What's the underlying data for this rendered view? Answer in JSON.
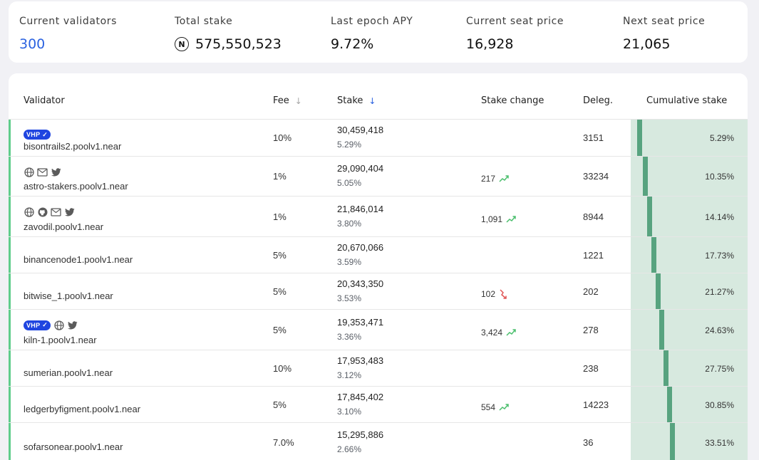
{
  "stats": {
    "current_validators_label": "Current validators",
    "current_validators_value": "300",
    "total_stake_label": "Total stake",
    "total_stake_icon": "near-token-icon",
    "total_stake_value": "575,550,523",
    "last_epoch_apy_label": "Last epoch APY",
    "last_epoch_apy_value": "9.72%",
    "current_seat_price_label": "Current seat price",
    "current_seat_price_value": "16,928",
    "next_seat_price_label": "Next seat price",
    "next_seat_price_value": "21,065"
  },
  "table": {
    "headers": {
      "validator": "Validator",
      "fee": "Fee",
      "stake": "Stake",
      "stake_change": "Stake change",
      "deleg": "Deleg.",
      "cumulative": "Cumulative stake"
    },
    "colors": {
      "accent": "#2b62e0",
      "row_marker": "#5fcd8b",
      "cumulative_bar": "#57a37f",
      "cumulative_bg": "#d7e9df",
      "trend_up": "#4cbf6e",
      "trend_down": "#e05555"
    },
    "rows": [
      {
        "name": "bisontrails2.poolv1.near",
        "badge": "VHP",
        "icons": [
          "verified-badge"
        ],
        "fee": "10%",
        "stake": "30,459,418",
        "stake_pct": "5.29%",
        "change": "",
        "trend": "",
        "deleg": "3151",
        "cum": "5.29%",
        "cum_frac": 0.0529
      },
      {
        "name": "astro-stakers.poolv1.near",
        "badge": "",
        "icons": [
          "globe-icon",
          "mail-icon",
          "twitter-icon"
        ],
        "fee": "1%",
        "stake": "29,090,404",
        "stake_pct": "5.05%",
        "change": "217",
        "trend": "up",
        "deleg": "33234",
        "cum": "10.35%",
        "cum_frac": 0.1035
      },
      {
        "name": "zavodil.poolv1.near",
        "badge": "",
        "icons": [
          "globe-icon",
          "github-icon",
          "mail-icon",
          "twitter-icon"
        ],
        "fee": "1%",
        "stake": "21,846,014",
        "stake_pct": "3.80%",
        "change": "1,091",
        "trend": "up",
        "deleg": "8944",
        "cum": "14.14%",
        "cum_frac": 0.1414
      },
      {
        "name": "binancenode1.poolv1.near",
        "badge": "",
        "icons": [],
        "fee": "5%",
        "stake": "20,670,066",
        "stake_pct": "3.59%",
        "change": "",
        "trend": "",
        "deleg": "1221",
        "cum": "17.73%",
        "cum_frac": 0.1773
      },
      {
        "name": "bitwise_1.poolv1.near",
        "badge": "",
        "icons": [],
        "fee": "5%",
        "stake": "20,343,350",
        "stake_pct": "3.53%",
        "change": "102",
        "trend": "down",
        "deleg": "202",
        "cum": "21.27%",
        "cum_frac": 0.2127
      },
      {
        "name": "kiln-1.poolv1.near",
        "badge": "VHP",
        "icons": [
          "globe-icon",
          "twitter-icon"
        ],
        "fee": "5%",
        "stake": "19,353,471",
        "stake_pct": "3.36%",
        "change": "3,424",
        "trend": "up",
        "deleg": "278",
        "cum": "24.63%",
        "cum_frac": 0.2463
      },
      {
        "name": "sumerian.poolv1.near",
        "badge": "",
        "icons": [],
        "fee": "10%",
        "stake": "17,953,483",
        "stake_pct": "3.12%",
        "change": "",
        "trend": "",
        "deleg": "238",
        "cum": "27.75%",
        "cum_frac": 0.2775
      },
      {
        "name": "ledgerbyfigment.poolv1.near",
        "badge": "",
        "icons": [],
        "fee": "5%",
        "stake": "17,845,402",
        "stake_pct": "3.10%",
        "change": "554",
        "trend": "up",
        "deleg": "14223",
        "cum": "30.85%",
        "cum_frac": 0.3085
      },
      {
        "name": "sofarsonear.poolv1.near",
        "badge": "",
        "icons": [],
        "fee": "7.0%",
        "stake": "15,295,886",
        "stake_pct": "2.66%",
        "change": "",
        "trend": "",
        "deleg": "36",
        "cum": "33.51%",
        "cum_frac": 0.3351
      }
    ]
  }
}
